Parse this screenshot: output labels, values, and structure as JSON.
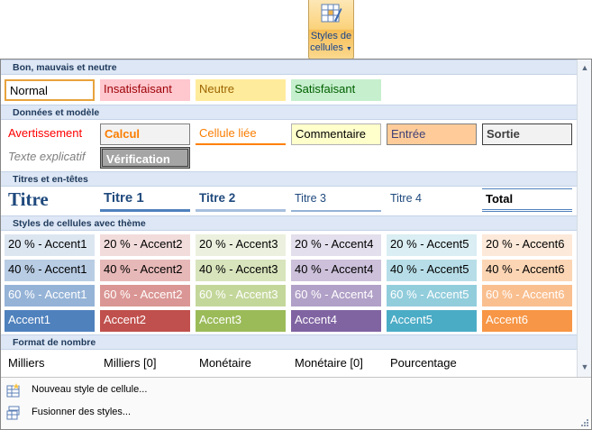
{
  "ribbon_button": {
    "line1": "Styles de",
    "line2": "cellules"
  },
  "sections": [
    {
      "title": "Bon, mauvais et neutre"
    },
    {
      "title": "Données et modèle"
    },
    {
      "title": "Titres et en-têtes"
    },
    {
      "title": "Styles de cellules avec thème"
    },
    {
      "title": "Format de nombre"
    }
  ],
  "good_bad": [
    "Normal",
    "Insatisfaisant",
    "Neutre",
    "Satisfaisant"
  ],
  "data_model": [
    "Avertissement",
    "Calcul",
    "Cellule liée",
    "Commentaire",
    "Entrée",
    "Sortie",
    "Texte explicatif",
    "Vérification"
  ],
  "titles": [
    "Titre",
    "Titre 1",
    "Titre 2",
    "Titre 3",
    "Titre 4",
    "Total"
  ],
  "themed": {
    "row20": [
      "20 % - Accent1",
      "20 % - Accent2",
      "20 % - Accent3",
      "20 % - Accent4",
      "20 % - Accent5",
      "20 % - Accent6"
    ],
    "row40": [
      "40 % - Accent1",
      "40 % - Accent2",
      "40 % - Accent3",
      "40 % - Accent4",
      "40 % - Accent5",
      "40 % - Accent6"
    ],
    "row60": [
      "60 % - Accent1",
      "60 % - Accent2",
      "60 % - Accent3",
      "60 % - Accent4",
      "60 % - Accent5",
      "60 % - Accent6"
    ],
    "accent": [
      "Accent1",
      "Accent2",
      "Accent3",
      "Accent4",
      "Accent5",
      "Accent6"
    ]
  },
  "number_format": [
    "Milliers",
    "Milliers [0]",
    "Monétaire",
    "Monétaire [0]",
    "Pourcentage"
  ],
  "menu": {
    "new_style": "Nouveau style de cellule...",
    "merge_styles": "Fusionner des styles..."
  },
  "colors": {
    "accent1": "#4f81bd",
    "accent2": "#c0504d",
    "accent3": "#9bbb59",
    "accent4": "#8064a2",
    "accent5": "#4bacc6",
    "accent6": "#f79646",
    "section_bg": "#dde7f5"
  }
}
